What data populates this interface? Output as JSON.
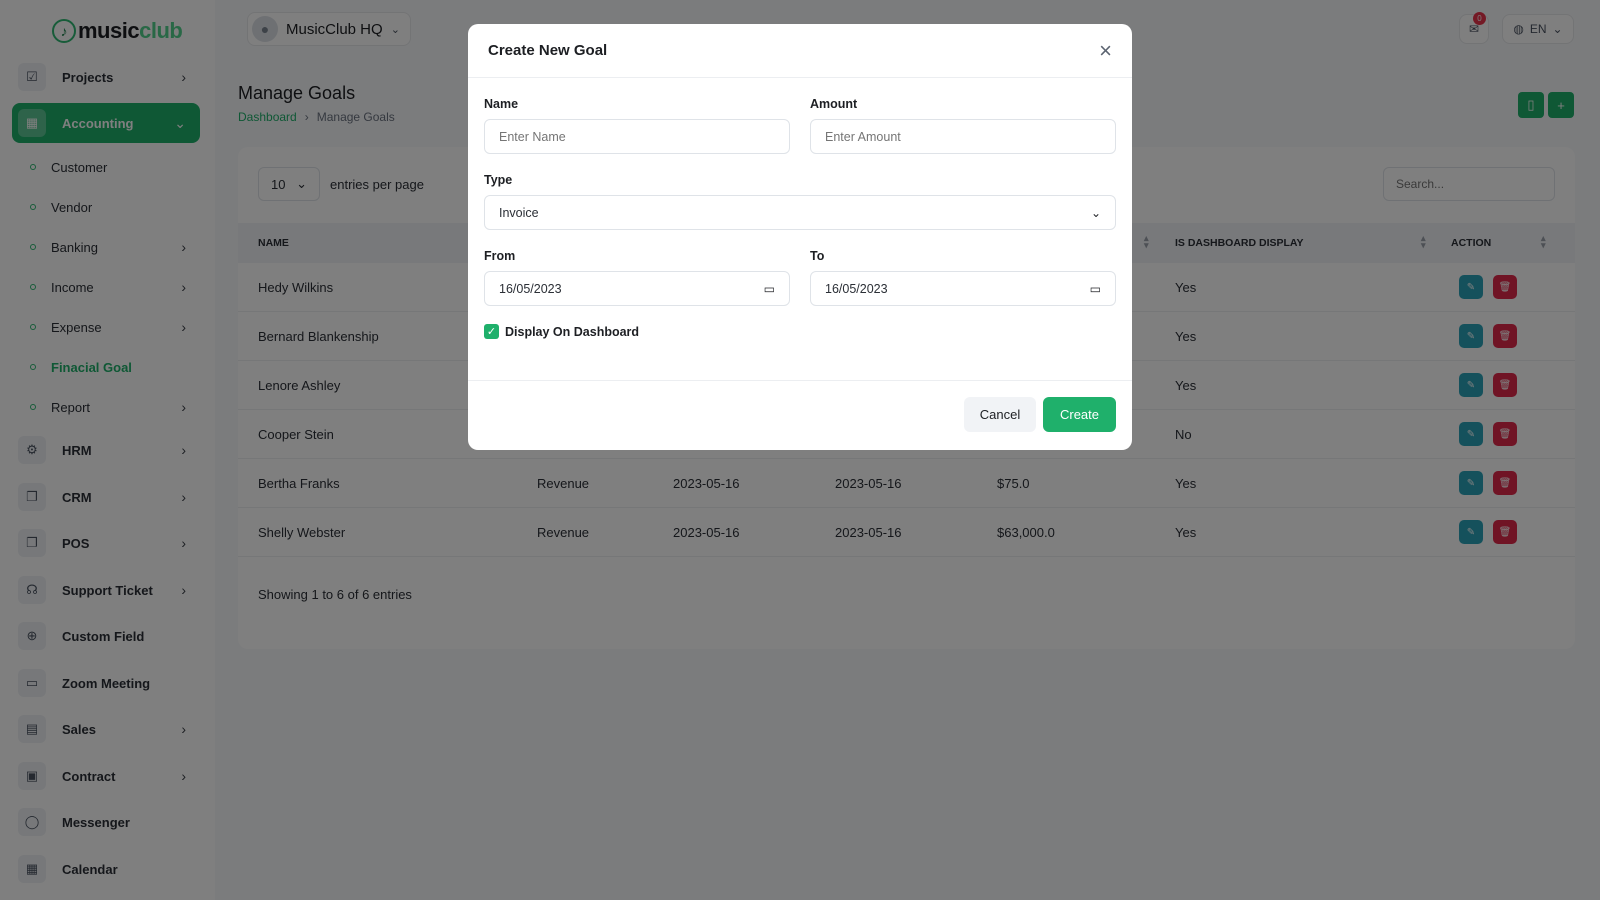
{
  "app": {
    "logo_text_main": "music",
    "logo_text_accent": "club",
    "workspace": "MusicClub HQ",
    "notification_count": "0",
    "language": "EN"
  },
  "sidebar": {
    "items": [
      {
        "label": "Projects",
        "icon": "check-square-icon",
        "has_chevron": true
      },
      {
        "label": "Accounting",
        "icon": "grid-icon",
        "has_chevron": true,
        "active": true
      },
      {
        "label": "HRM",
        "icon": "users-icon",
        "has_chevron": true
      },
      {
        "label": "CRM",
        "icon": "layers-icon",
        "has_chevron": true
      },
      {
        "label": "POS",
        "icon": "layers-icon",
        "has_chevron": true
      },
      {
        "label": "Support Ticket",
        "icon": "headphones-icon",
        "has_chevron": true
      },
      {
        "label": "Custom Field",
        "icon": "plus-circle-icon",
        "has_chevron": false
      },
      {
        "label": "Zoom Meeting",
        "icon": "video-icon",
        "has_chevron": false
      },
      {
        "label": "Sales",
        "icon": "file-icon",
        "has_chevron": true
      },
      {
        "label": "Contract",
        "icon": "clipboard-icon",
        "has_chevron": true
      },
      {
        "label": "Messenger",
        "icon": "message-icon",
        "has_chevron": false
      },
      {
        "label": "Calendar",
        "icon": "calendar-icon",
        "has_chevron": false
      }
    ],
    "accounting_sub": [
      {
        "label": "Customer",
        "has_chevron": false
      },
      {
        "label": "Vendor",
        "has_chevron": false
      },
      {
        "label": "Banking",
        "has_chevron": true
      },
      {
        "label": "Income",
        "has_chevron": true
      },
      {
        "label": "Expense",
        "has_chevron": true
      },
      {
        "label": "Finacial Goal",
        "has_chevron": false,
        "active": true
      },
      {
        "label": "Report",
        "has_chevron": true
      }
    ]
  },
  "page": {
    "title": "Manage Goals",
    "breadcrumb": [
      "Dashboard",
      "Manage Goals"
    ]
  },
  "table": {
    "entries_value": "10",
    "entries_label": "entries per page",
    "search_placeholder": "Search...",
    "headers": {
      "name": "NAME",
      "is_dashboard_display": "IS DASHBOARD DISPLAY",
      "action": "ACTION"
    },
    "rows": [
      {
        "name": "Hedy Wilkins",
        "type": "",
        "from": "",
        "to": "",
        "amount": "",
        "display": "Yes"
      },
      {
        "name": "Bernard Blankenship",
        "type": "",
        "from": "",
        "to": "",
        "amount": "",
        "display": "Yes"
      },
      {
        "name": "Lenore Ashley",
        "type": "",
        "from": "",
        "to": "",
        "amount": "",
        "display": "Yes"
      },
      {
        "name": "Cooper Stein",
        "type": "",
        "from": "",
        "to": "",
        "amount": "",
        "display": "No"
      },
      {
        "name": "Bertha Franks",
        "type": "Revenue",
        "from": "2023-05-16",
        "to": "2023-05-16",
        "amount": "$75.0",
        "display": "Yes"
      },
      {
        "name": "Shelly Webster",
        "type": "Revenue",
        "from": "2023-05-16",
        "to": "2023-05-16",
        "amount": "$63,000.0",
        "display": "Yes"
      }
    ],
    "footer": "Showing 1 to 6 of 6 entries"
  },
  "modal": {
    "title": "Create New Goal",
    "name_label": "Name",
    "name_placeholder": "Enter Name",
    "amount_label": "Amount",
    "amount_placeholder": "Enter Amount",
    "type_label": "Type",
    "type_value": "Invoice",
    "from_label": "From",
    "from_value": "16/05/2023",
    "to_label": "To",
    "to_value": "16/05/2023",
    "display_label": "Display On Dashboard",
    "display_checked": true,
    "cancel_label": "Cancel",
    "create_label": "Create"
  },
  "colors": {
    "brand": "#1fb06b",
    "edit": "#2aa3b8",
    "delete": "#e0284a"
  }
}
